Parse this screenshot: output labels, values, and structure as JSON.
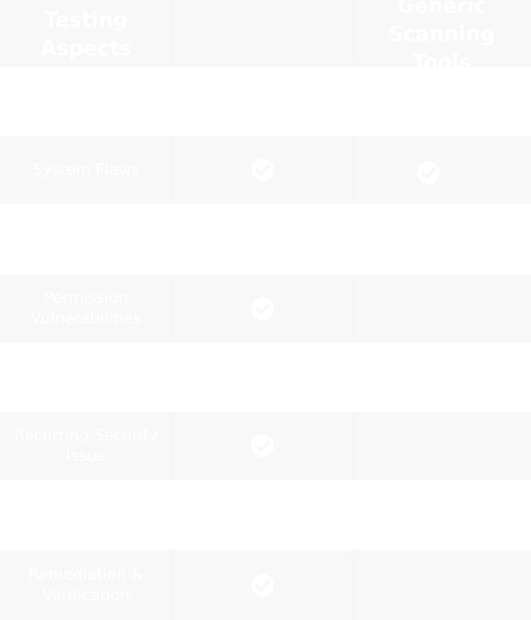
{
  "header": {
    "col1": "Testing Aspects",
    "col2": "",
    "col3": "Generic Scanning Tools"
  },
  "rows": [
    {
      "aspect": "System Flaws",
      "col2_check": true,
      "col3_check": true
    },
    {
      "aspect": "Permission Vulnerabilities",
      "col2_check": true,
      "col3_check": false
    },
    {
      "aspect": "Recurring Security Issue",
      "col2_check": true,
      "col3_check": false
    },
    {
      "aspect": "Remediation & Verification",
      "col2_check": true,
      "col3_check": false
    }
  ],
  "icons": {
    "check": "check-circle-icon"
  },
  "colors": {
    "row_shaded": "#f8f8f8",
    "text": "#ffffff"
  }
}
